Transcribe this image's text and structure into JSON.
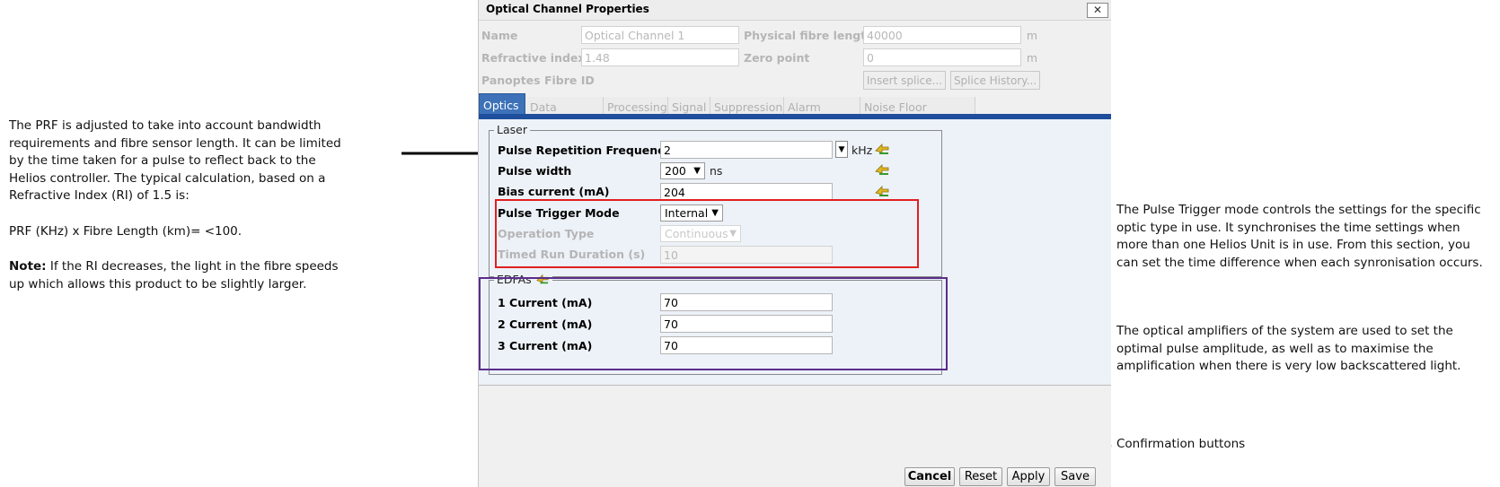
{
  "annotations": {
    "prf": {
      "p1": "The PRF is adjusted to take into account bandwidth requirements and fibre sensor length. It can be limited by the time taken for a pulse to reflect back to the Helios controller. The typical calculation, based on a Refractive Index (RI) of 1.5 is:",
      "p2": "PRF (KHz) x Fibre Length (km)= <100.",
      "note_label": "Note:",
      "note_text": " If the RI decreases, the light in the fibre speeds up which allows this product to be slightly larger."
    },
    "trigger": "The Pulse Trigger mode controls the settings for the specific optic type in use. It synchronises the time settings when more than one Helios Unit is in use. From this section, you can set the time difference when each synronisation occurs.",
    "amplifiers": "The optical amplifiers of the system are used to set the optimal pulse amplitude, as well as to maximise the amplification when there is very low backscattered light.",
    "confirm": "Confirmation buttons"
  },
  "dialog": {
    "title": "Optical Channel Properties",
    "close_symbol": "✕",
    "header": {
      "name_label": "Name",
      "name_value": "Optical Channel 1",
      "length_label": "Physical fibre length",
      "length_value": "40000",
      "length_unit": "m",
      "ri_label": "Refractive index",
      "ri_value": "1.48",
      "zero_label": "Zero point",
      "zero_value": "0",
      "zero_unit": "m",
      "fibre_id_label": "Panoptes Fibre ID",
      "insert_splice": "Insert splice...",
      "splice_history": "Splice History..."
    },
    "tabs": [
      "Optics",
      "Data Capture",
      "Processing",
      "Signal",
      "Suppression",
      "Alarm Report",
      "Noise Floor Bounding"
    ],
    "laser": {
      "legend": "Laser",
      "prf_label": "Pulse Repetition Frequency",
      "prf_value": "2",
      "prf_unit": "kHz",
      "pw_label": "Pulse width",
      "pw_value": "200",
      "pw_unit": "ns",
      "bias_label": "Bias current (mA)",
      "bias_value": "204",
      "trigger_label": "Pulse Trigger Mode",
      "trigger_value": "Internal",
      "op_label": "Operation Type",
      "op_value": "Continuous",
      "timed_label": "Timed Run Duration (s)",
      "timed_value": "10"
    },
    "edfas": {
      "legend": "EDFAs",
      "c1_label": "1 Current (mA)",
      "c1_value": "70",
      "c2_label": "2 Current (mA)",
      "c2_value": "70",
      "c3_label": "3 Current (mA)",
      "c3_value": "70"
    },
    "buttons": {
      "cancel": "Cancel",
      "reset": "Reset",
      "apply": "Apply",
      "save": "Save"
    }
  },
  "colors": {
    "tab_active": "#3d72b8",
    "highlight_red": "#e02020",
    "highlight_purple": "#5a2d8c"
  },
  "icons": [
    "pulse-arrows-icon",
    "close-icon",
    "dropdown-arrow-icon"
  ]
}
